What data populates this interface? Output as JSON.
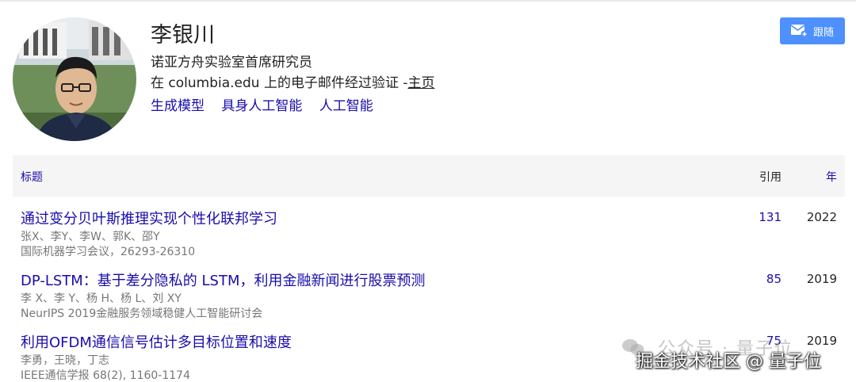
{
  "profile": {
    "name": "李银川",
    "affiliation": "诺亚方舟实验室首席研究员",
    "verified_prefix": "在 columbia.edu 上的电子邮件经过验证 -",
    "homepage_label": "主页",
    "interests": [
      "生成模型",
      "具身人工智能",
      "人工智能"
    ]
  },
  "follow_button": {
    "label": "跟随",
    "icon": "envelope-plus-icon",
    "color": "#4d90fe"
  },
  "table": {
    "headers": {
      "title": "标题",
      "cited": "引用",
      "year": "年"
    },
    "rows": [
      {
        "title": "通过变分贝叶斯推理实现个性化联邦学习",
        "authors": "张X、李Y、李W、郭K、邵Y",
        "venue": "国际机器学习会议，26293-26310",
        "cited": "131",
        "year": "2022"
      },
      {
        "title": "DP-LSTM：基于差分隐私的 LSTM，利用金融新闻进行股票预测",
        "authors": "李 X、李 Y、杨 H、杨 L、刘 XY",
        "venue": "NeurIPS 2019金融服务领域稳健人工智能研讨会",
        "cited": "85",
        "year": "2019"
      },
      {
        "title": "利用OFDM通信信号估计多目标位置和速度",
        "authors": "李勇，王晓，丁志",
        "venue": "IEEE通信学报 68(2), 1160-1174",
        "cited": "75",
        "year": "2019"
      }
    ]
  },
  "watermark": {
    "faint": "公众号 · 量子位",
    "main": "掘金技术社区 @ 量子位"
  },
  "colors": {
    "link": "#1a0dab",
    "meta": "#777777",
    "header_bg": "#f5f5f5"
  }
}
